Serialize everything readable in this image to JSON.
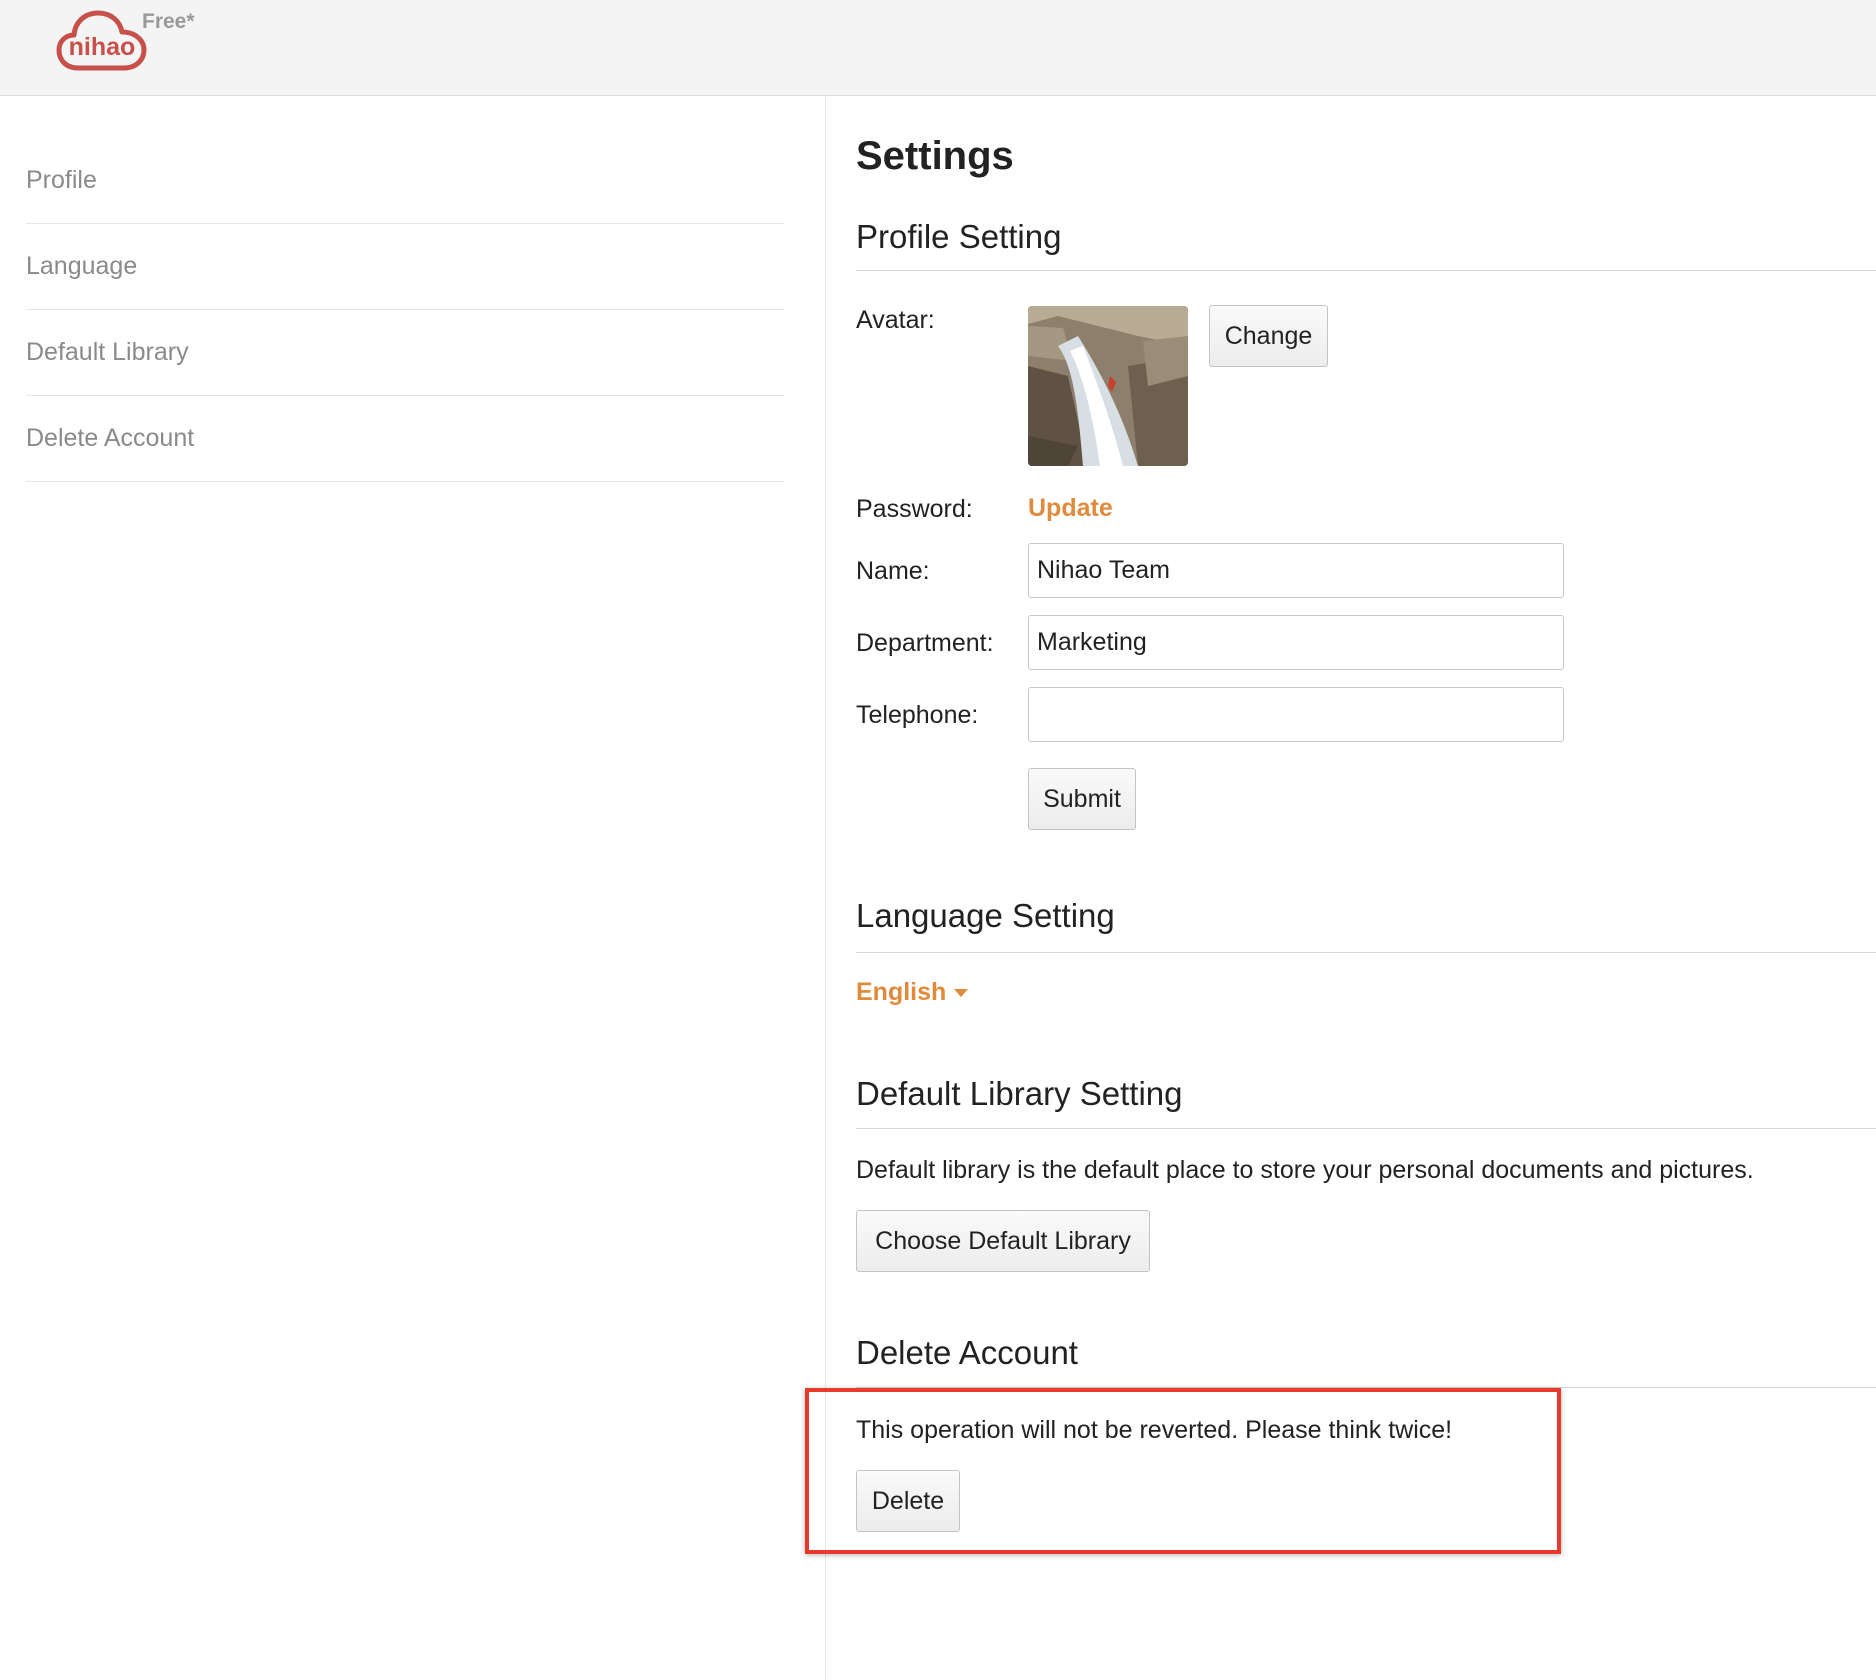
{
  "brand": {
    "logo_text": "nihao",
    "plan_badge": "Free*",
    "logo_color": "#c7504b"
  },
  "sidebar": {
    "items": [
      {
        "label": "Profile"
      },
      {
        "label": "Language"
      },
      {
        "label": "Default Library"
      },
      {
        "label": "Delete Account"
      }
    ]
  },
  "main": {
    "title": "Settings",
    "profile": {
      "heading": "Profile Setting",
      "avatar_label": "Avatar:",
      "change_button": "Change",
      "password_label": "Password:",
      "password_link": "Update",
      "name_label": "Name:",
      "name_value": "Nihao Team",
      "department_label": "Department:",
      "department_value": "Marketing",
      "telephone_label": "Telephone:",
      "telephone_value": "",
      "submit_button": "Submit"
    },
    "language": {
      "heading": "Language Setting",
      "selected": "English"
    },
    "default_library": {
      "heading": "Default Library Setting",
      "description": "Default library is the default place to store your personal documents and pictures.",
      "button": "Choose Default Library"
    },
    "delete_account": {
      "heading": "Delete Account",
      "warning": "This operation will not be reverted. Please think twice!",
      "button": "Delete"
    }
  },
  "colors": {
    "accent": "#e08a3c",
    "highlight_box": "#e83a2a",
    "header_bg": "#f4f4f4"
  },
  "icons": {
    "logo": "cloud-logo-icon",
    "language_dropdown": "caret-down-icon"
  }
}
